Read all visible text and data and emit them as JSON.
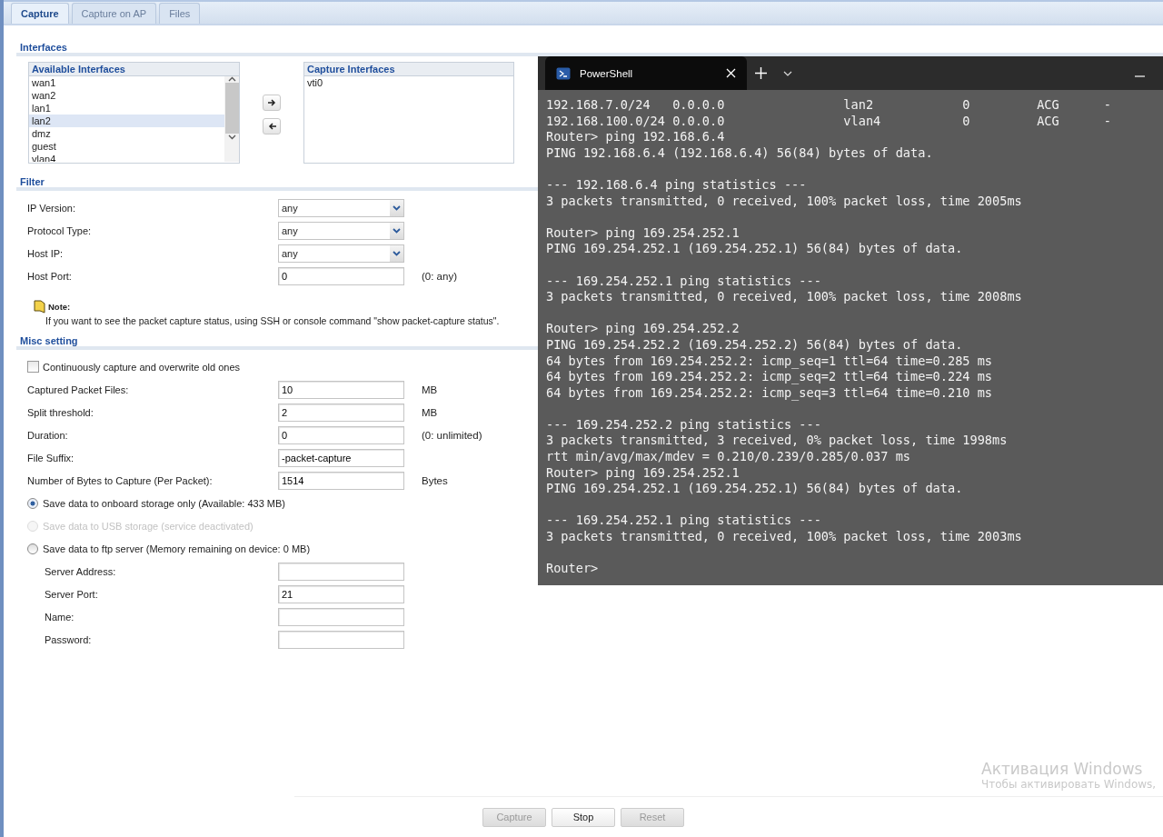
{
  "tabs": [
    {
      "label": "Capture",
      "selected": true
    },
    {
      "label": "Capture on AP",
      "selected": false
    },
    {
      "label": "Files",
      "selected": false
    }
  ],
  "interfaces": {
    "title": "Interfaces",
    "available": {
      "header": "Available Interfaces",
      "items": [
        {
          "label": "wan1",
          "selected": false
        },
        {
          "label": "wan2",
          "selected": false
        },
        {
          "label": "lan1",
          "selected": false
        },
        {
          "label": "lan2",
          "selected": true
        },
        {
          "label": "dmz",
          "selected": false
        },
        {
          "label": "guest",
          "selected": false
        },
        {
          "label": "vlan4",
          "selected": false
        }
      ]
    },
    "capture": {
      "header": "Capture Interfaces",
      "items": [
        {
          "label": "vti0",
          "selected": false
        }
      ]
    }
  },
  "filter": {
    "title": "Filter",
    "rows": [
      {
        "kind": "select",
        "label": "IP Version:",
        "value": "any"
      },
      {
        "kind": "select",
        "label": "Protocol Type:",
        "value": "any"
      },
      {
        "kind": "select",
        "label": "Host IP:",
        "value": "any"
      },
      {
        "kind": "text",
        "label": "Host Port:",
        "value": "0",
        "unit": "(0: any)"
      }
    ]
  },
  "note": {
    "title": "Note:",
    "text": "If you want to see the packet capture status, using SSH or console command \"show packet-capture status\"."
  },
  "misc": {
    "title": "Misc setting",
    "rows": [
      {
        "kind": "checkbox",
        "label": "Continuously capture and overwrite old ones",
        "checked": false
      },
      {
        "kind": "text",
        "label": "Captured Packet Files:",
        "value": "10",
        "unit": "MB"
      },
      {
        "kind": "text",
        "label": "Split threshold:",
        "value": "2",
        "unit": "MB"
      },
      {
        "kind": "text",
        "label": "Duration:",
        "value": "0",
        "unit": "(0: unlimited)"
      },
      {
        "kind": "text",
        "label": "File Suffix:",
        "value": "-packet-capture"
      },
      {
        "kind": "text",
        "label": "Number of Bytes to Capture (Per Packet):",
        "value": "1514",
        "unit": "Bytes"
      },
      {
        "kind": "radio",
        "label": "Save data to onboard storage only (Available: 433 MB)",
        "selected": true,
        "disabled": false
      },
      {
        "kind": "radio",
        "label": "Save data to USB storage (service deactivated)",
        "selected": false,
        "disabled": true
      },
      {
        "kind": "radio",
        "label": "Save data to ftp server (Memory remaining on device: 0 MB)",
        "selected": false,
        "disabled": false
      },
      {
        "kind": "subfield",
        "label": "Server Address:"
      },
      {
        "kind": "subfield",
        "label": "Server Port:",
        "value": "21"
      },
      {
        "kind": "subfield",
        "label": "Name:"
      },
      {
        "kind": "subfield",
        "label": "Password:"
      }
    ]
  },
  "buttons": [
    {
      "label": "Capture",
      "disabled": true
    },
    {
      "label": "Stop",
      "disabled": false
    },
    {
      "label": "Reset",
      "disabled": true
    }
  ],
  "terminal": {
    "tab_title": "PowerShell",
    "blocks": [
      [
        "192.168.7.0/24   0.0.0.0                lan2            0         ACG      -",
        "192.168.100.0/24 0.0.0.0                vlan4           0         ACG      -",
        "Router> ping 192.168.6.4",
        "PING 192.168.6.4 (192.168.6.4) 56(84) bytes of data."
      ],
      [
        "--- 192.168.6.4 ping statistics ---",
        "3 packets transmitted, 0 received, 100% packet loss, time 2005ms"
      ],
      [
        "Router> ping 169.254.252.1",
        "PING 169.254.252.1 (169.254.252.1) 56(84) bytes of data."
      ],
      [
        "--- 169.254.252.1 ping statistics ---",
        "3 packets transmitted, 0 received, 100% packet loss, time 2008ms"
      ],
      [
        "Router> ping 169.254.252.2",
        "PING 169.254.252.2 (169.254.252.2) 56(84) bytes of data.",
        "64 bytes from 169.254.252.2: icmp_seq=1 ttl=64 time=0.285 ms",
        "64 bytes from 169.254.252.2: icmp_seq=2 ttl=64 time=0.224 ms",
        "64 bytes from 169.254.252.2: icmp_seq=3 ttl=64 time=0.210 ms"
      ],
      [
        "--- 169.254.252.2 ping statistics ---",
        "3 packets transmitted, 3 received, 0% packet loss, time 1998ms",
        "rtt min/avg/max/mdev = 0.210/0.239/0.285/0.037 ms",
        "Router> ping 169.254.252.1",
        "PING 169.254.252.1 (169.254.252.1) 56(84) bytes of data."
      ],
      [
        "--- 169.254.252.1 ping statistics ---",
        "3 packets transmitted, 0 received, 100% packet loss, time 2003ms"
      ],
      [
        "Router>"
      ]
    ]
  },
  "watermark": {
    "title": "Активация Windows",
    "text": "Чтобы активировать Windows,"
  }
}
